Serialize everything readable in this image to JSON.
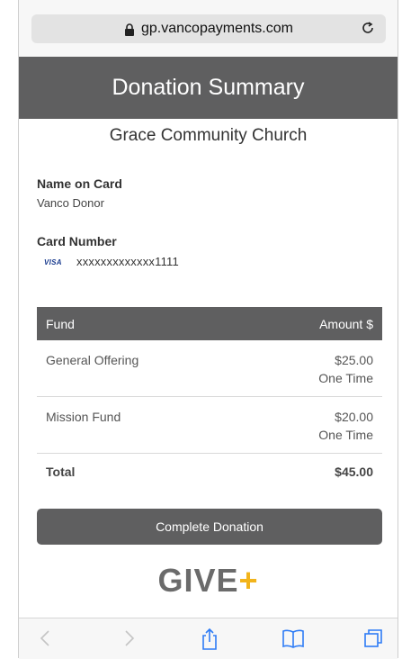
{
  "browser": {
    "url": "gp.vancopayments.com",
    "icons": [
      "lock-icon",
      "reload-icon",
      "back-icon",
      "forward-icon",
      "share-icon",
      "bookmarks-icon",
      "tabs-icon"
    ]
  },
  "header": {
    "title": "Donation Summary"
  },
  "church_name": "Grace Community Church",
  "card": {
    "name_label": "Name on Card",
    "name_value": "Vanco Donor",
    "number_label": "Card Number",
    "brand": "VISA",
    "number_value": "xxxxxxxxxxxxx1111"
  },
  "table": {
    "headers": {
      "fund": "Fund",
      "amount": "Amount $"
    },
    "rows": [
      {
        "fund": "General Offering",
        "amount": "$25.00",
        "frequency": "One Time"
      },
      {
        "fund": "Mission Fund",
        "amount": "$20.00",
        "frequency": "One Time"
      }
    ],
    "total_label": "Total",
    "total_value": "$45.00"
  },
  "actions": {
    "complete_label": "Complete Donation"
  },
  "logo": {
    "text": "GIVE",
    "plus": "+",
    "accent": "#f2b41b"
  },
  "colors": {
    "header_bg": "#5f5f60",
    "accent": "#f2b41b"
  }
}
